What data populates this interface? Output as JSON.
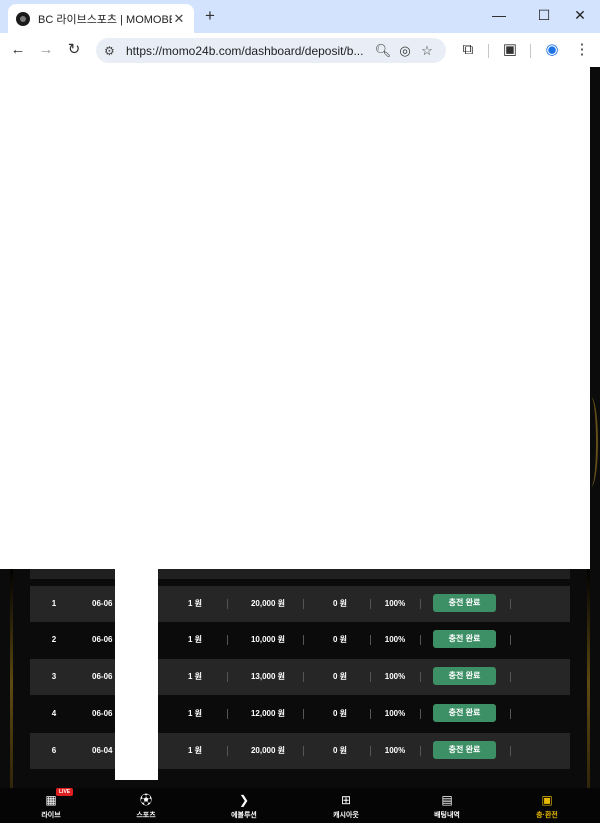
{
  "browser": {
    "tab_title": "BC 라이브스포츠 | MOMOBET",
    "tab_close": "✕",
    "new_tab": "+",
    "url": "https://momo24b.com/dashboard/deposit/b...",
    "window": {
      "minimize": "—",
      "maximize": "☐",
      "close": "✕"
    },
    "icons": {
      "back": "back-arrow-icon",
      "forward": "forward-arrow-icon",
      "reload": "reload-icon",
      "site_info": "tune-icon",
      "zoom": "zoom-icon",
      "eye_off": "eye-off-icon",
      "star": "star-icon",
      "extensions": "puzzle-icon",
      "tab_search": "tab-search-icon",
      "profile": "profile-icon",
      "menu": "kebab-menu-icon"
    }
  },
  "deposits": [
    {
      "index": "1",
      "date": "06-06",
      "qty": "1 원",
      "amount": "20,000 원",
      "bonus": "0 원",
      "rate": "100%",
      "status": "충전 완료"
    },
    {
      "index": "2",
      "date": "06-06",
      "qty": "1 원",
      "amount": "10,000 원",
      "bonus": "0 원",
      "rate": "100%",
      "status": "충전 완료"
    },
    {
      "index": "3",
      "date": "06-06",
      "qty": "1 원",
      "amount": "13,000 원",
      "bonus": "0 원",
      "rate": "100%",
      "status": "충전 완료"
    },
    {
      "index": "4",
      "date": "06-06",
      "qty": "1 원",
      "amount": "12,000 원",
      "bonus": "0 원",
      "rate": "100%",
      "status": "충전 완료"
    },
    {
      "index": "6",
      "date": "06-04",
      "qty": "1 원",
      "amount": "20,000 원",
      "bonus": "0 원",
      "rate": "100%",
      "status": "충전 완료"
    }
  ],
  "bottom_nav": [
    {
      "label": "라이브",
      "icon": "live-icon",
      "badge": "LIVE",
      "active": false
    },
    {
      "label": "스포츠",
      "icon": "soccer-ball-icon",
      "active": false
    },
    {
      "label": "에볼루션",
      "icon": "evolution-icon",
      "active": false
    },
    {
      "label": "캐시아웃",
      "icon": "cashout-icon",
      "active": false
    },
    {
      "label": "배팅내역",
      "icon": "document-icon",
      "active": false
    },
    {
      "label": "충·환전",
      "icon": "exchange-icon",
      "active": true
    }
  ],
  "colors": {
    "status_badge": "#3d8f66",
    "active_nav": "#e6b800",
    "gold_border": "#5e4a12"
  }
}
